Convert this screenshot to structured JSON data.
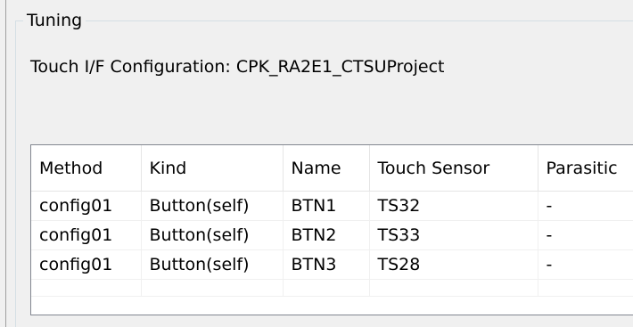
{
  "group": {
    "title": "Tuning"
  },
  "config_label": "Touch I/F Configuration: CPK_RA2E1_CTSUProject",
  "table": {
    "columns": [
      "Method",
      "Kind",
      "Name",
      "Touch Sensor",
      "Parasitic"
    ],
    "rows": [
      [
        "config01",
        "Button(self)",
        "BTN1",
        "TS32",
        "-"
      ],
      [
        "config01",
        "Button(self)",
        "BTN2",
        "TS33",
        "-"
      ],
      [
        "config01",
        "Button(self)",
        "BTN3",
        "TS28",
        "-"
      ]
    ]
  }
}
